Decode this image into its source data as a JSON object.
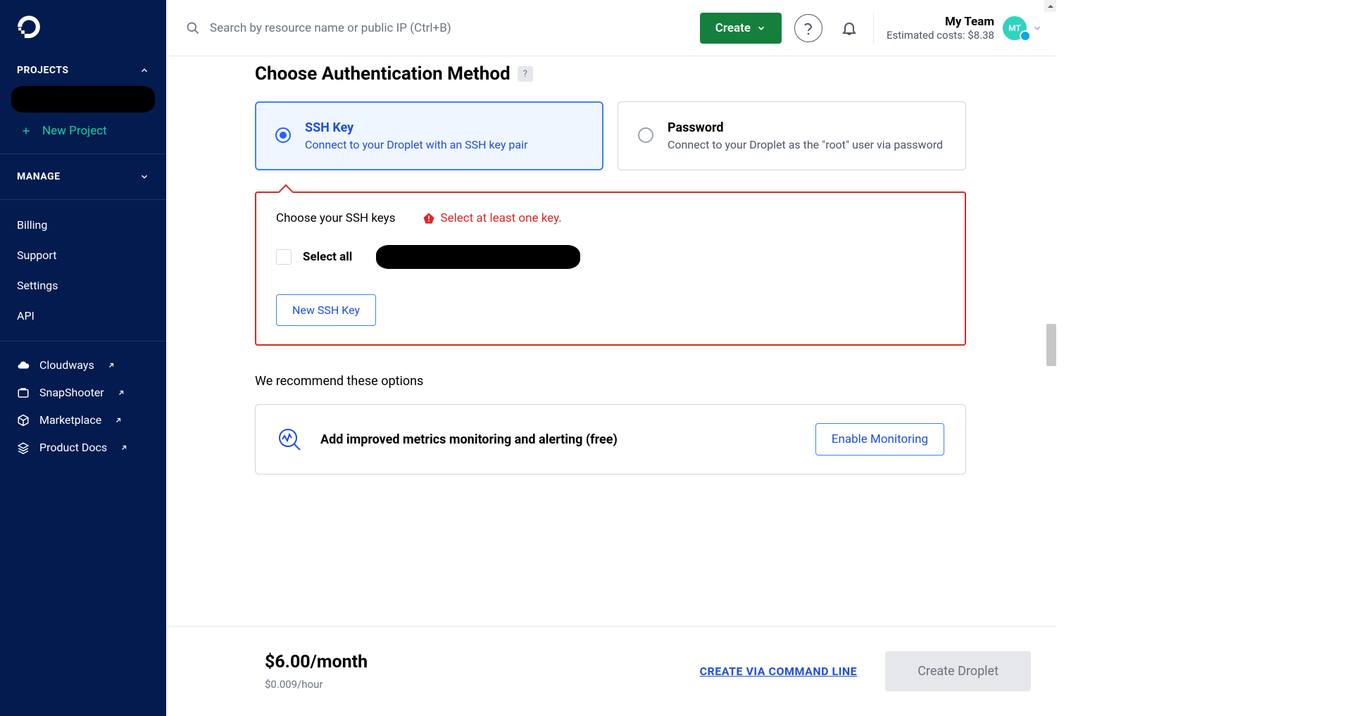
{
  "sidebar": {
    "projects_label": "PROJECTS",
    "new_project": "New Project",
    "manage_label": "MANAGE",
    "manage_items": [
      "Billing",
      "Support",
      "Settings",
      "API"
    ],
    "external": [
      "Cloudways",
      "SnapShooter",
      "Marketplace",
      "Product Docs"
    ]
  },
  "topbar": {
    "search_placeholder": "Search by resource name or public IP (Ctrl+B)",
    "create": "Create",
    "team_name": "My Team",
    "costs": "Estimated costs: $8.38",
    "avatar_initials": "MT"
  },
  "auth": {
    "section_title": "Choose Authentication Method",
    "ssh": {
      "title": "SSH Key",
      "desc": "Connect to your Droplet with an SSH key pair"
    },
    "pwd": {
      "title": "Password",
      "desc": "Connect to your Droplet as the \"root\" user via password"
    }
  },
  "ssh_box": {
    "title": "Choose your SSH keys",
    "error": "Select at least one key.",
    "select_all": "Select all",
    "new_key": "New SSH Key"
  },
  "rec": {
    "heading": "We recommend these options",
    "item_title": "Add improved metrics monitoring and alerting (free)",
    "enable": "Enable Monitoring"
  },
  "footer": {
    "price": "$6.00/month",
    "hourly": "$0.009/hour",
    "cli": "CREATE VIA COMMAND LINE",
    "create_droplet": "Create Droplet"
  }
}
